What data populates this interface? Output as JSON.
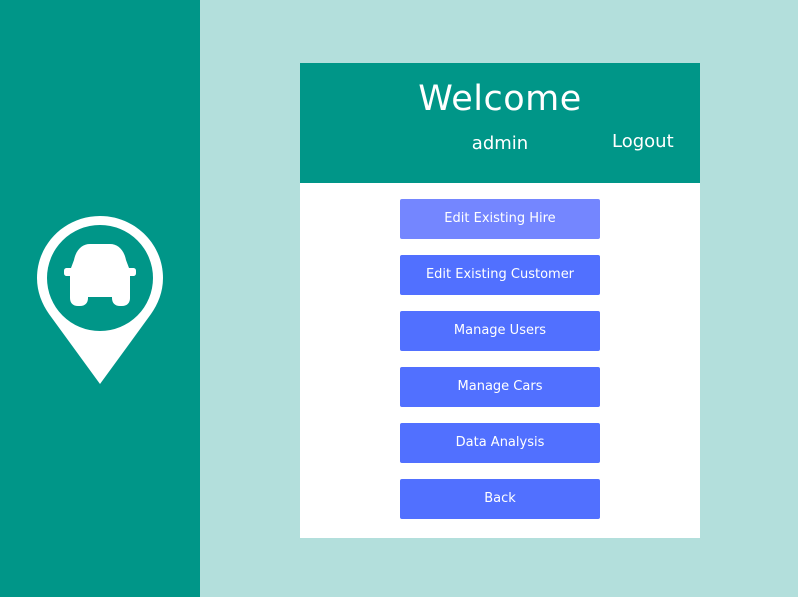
{
  "colors": {
    "background": "#b3dfdc",
    "sidebar": "#009688",
    "header": "#009688",
    "panel": "#ffffff",
    "button": "#5170ff",
    "button_hover": "#7486ff",
    "text_on_dark": "#ffffff"
  },
  "sidebar": {
    "logo_icon": "car-location-pin-icon"
  },
  "header": {
    "title": "Welcome",
    "username": "admin",
    "logout_label": "Logout"
  },
  "menu": {
    "items": [
      {
        "label": "Edit Existing Hire",
        "state": "hover"
      },
      {
        "label": "Edit Existing Customer"
      },
      {
        "label": "Manage Users"
      },
      {
        "label": "Manage Cars"
      },
      {
        "label": "Data Analysis"
      },
      {
        "label": "Back"
      }
    ]
  }
}
